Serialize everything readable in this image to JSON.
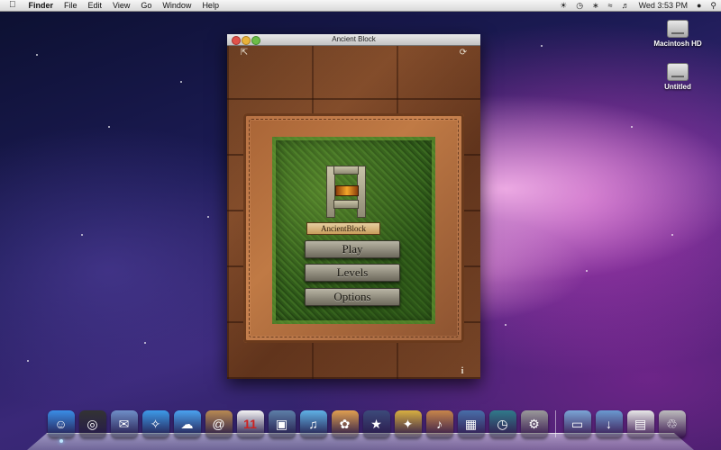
{
  "menubar": {
    "app_name": "Finder",
    "items": [
      "File",
      "Edit",
      "View",
      "Go",
      "Window",
      "Help"
    ],
    "clock": "Wed 3:53 PM"
  },
  "desktop_icons": [
    {
      "label": "Macintosh HD",
      "icon": "hard-drive-icon"
    },
    {
      "label": "Untitled",
      "icon": "hard-drive-icon"
    }
  ],
  "window": {
    "title": "Ancient Block",
    "game": {
      "logo_text": "AncientBlock",
      "buttons": [
        "Play",
        "Levels",
        "Options"
      ],
      "info_label": "i"
    }
  },
  "dock": {
    "apps": [
      {
        "name": "Finder",
        "icon": "finder-icon",
        "color": "#3a8ee6",
        "running": true
      },
      {
        "name": "Dashboard",
        "icon": "dashboard-icon",
        "color": "#333333",
        "running": false
      },
      {
        "name": "Mail",
        "icon": "mail-icon",
        "color": "#6f8fc8",
        "running": false
      },
      {
        "name": "Safari",
        "icon": "safari-icon",
        "color": "#3d9be9",
        "running": false
      },
      {
        "name": "iChat",
        "icon": "ichat-icon",
        "color": "#4aa3f0",
        "running": false
      },
      {
        "name": "Address Book",
        "icon": "address-book-icon",
        "color": "#b98a52",
        "running": false
      },
      {
        "name": "iCal",
        "icon": "ical-icon",
        "color": "#f4f4f4",
        "running": false
      },
      {
        "name": "Preview",
        "icon": "preview-icon",
        "color": "#5d7fa8",
        "running": false
      },
      {
        "name": "iTunes",
        "icon": "itunes-icon",
        "color": "#5fb2e6",
        "running": false
      },
      {
        "name": "iPhoto",
        "icon": "iphoto-icon",
        "color": "#e0a050",
        "running": false
      },
      {
        "name": "iMovie",
        "icon": "imovie-icon",
        "color": "#3c4a7a",
        "running": false
      },
      {
        "name": "iWeb",
        "icon": "iweb-icon",
        "color": "#d8b040",
        "running": false
      },
      {
        "name": "GarageBand",
        "icon": "garageband-icon",
        "color": "#c8864a",
        "running": false
      },
      {
        "name": "Spaces",
        "icon": "spaces-icon",
        "color": "#486ea8",
        "running": false
      },
      {
        "name": "Time Machine",
        "icon": "time-machine-icon",
        "color": "#2f7a8a",
        "running": false
      },
      {
        "name": "System Preferences",
        "icon": "system-preferences-icon",
        "color": "#9a9a9a",
        "running": false
      }
    ],
    "stacks": [
      {
        "name": "Applications",
        "icon": "applications-folder-icon",
        "color": "#7aa6d6"
      },
      {
        "name": "Downloads",
        "icon": "downloads-folder-icon",
        "color": "#6a9ad0"
      },
      {
        "name": "Documents",
        "icon": "documents-stack-icon",
        "color": "#e8e8e8"
      },
      {
        "name": "Trash",
        "icon": "trash-icon",
        "color": "#bdbdbd"
      }
    ]
  }
}
